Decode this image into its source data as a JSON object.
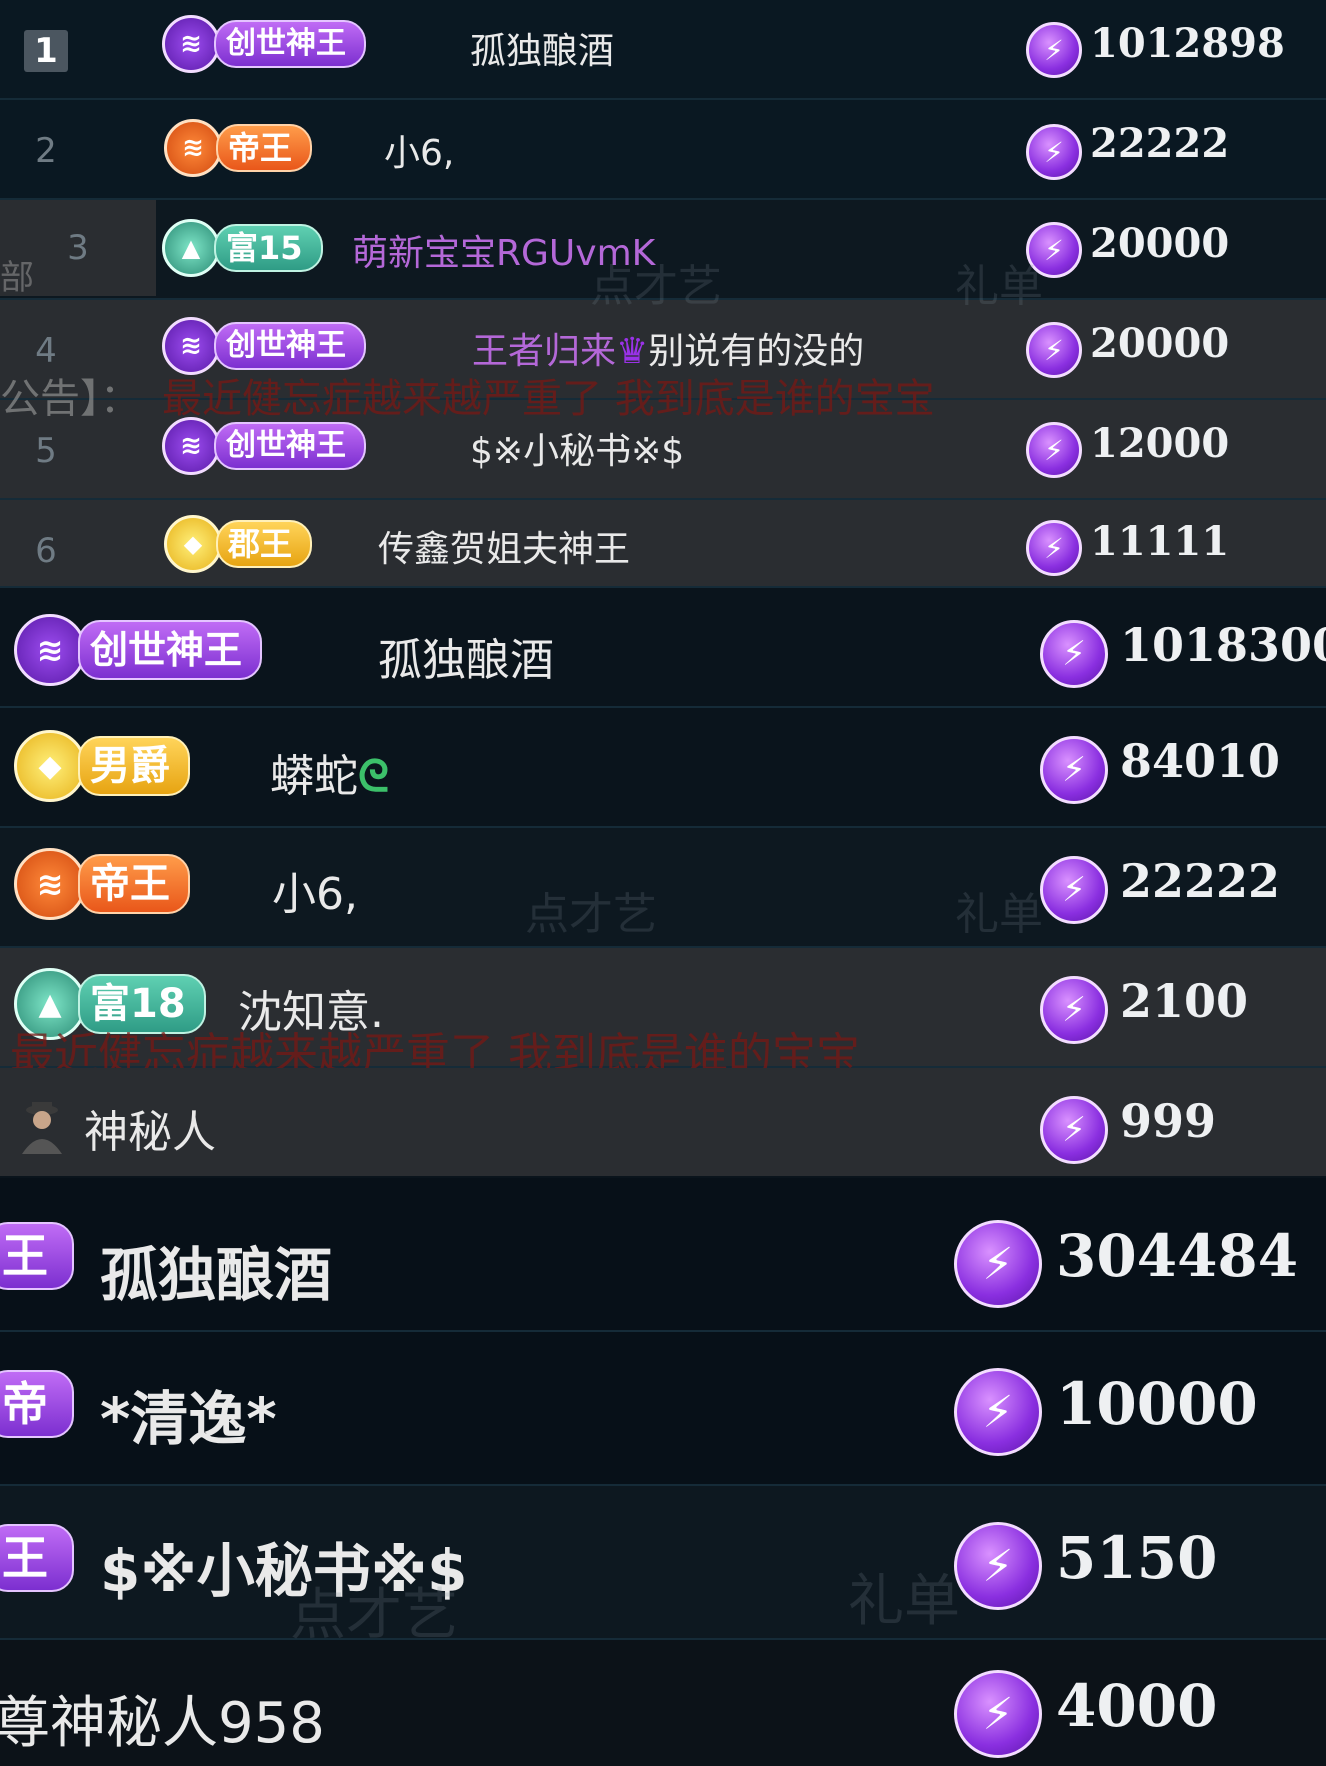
{
  "panel1": {
    "rows": [
      {
        "rank": "1",
        "badge": "创世神王",
        "name": "孤独酿酒",
        "score": "1012898"
      },
      {
        "rank": "2",
        "badge": "帝王",
        "name": "小6,",
        "score": "22222"
      },
      {
        "rank": "3",
        "badge": "富15",
        "name": "萌新宝宝RGUvmK",
        "score": "20000"
      },
      {
        "rank": "4",
        "badge": "创世神王",
        "name": "王者归来",
        "name_suffix": "别说有的没的",
        "score": "20000"
      },
      {
        "rank": "5",
        "badge": "创世神王",
        "name": "$※小秘书※$",
        "score": "12000"
      },
      {
        "rank": "6",
        "badge": "郡王",
        "name": "传鑫贺姐夫神王",
        "score": "11111"
      }
    ],
    "announcement_prefix": "公告】：",
    "announcement": "最近健忘症越来越严重了 我到底是谁的宝宝",
    "side_label_left": "部",
    "watermarks": [
      "点才艺",
      "礼单"
    ]
  },
  "panel2": {
    "rows": [
      {
        "badge": "创世神王",
        "name": "孤独酿酒",
        "score": "1018300"
      },
      {
        "badge": "男爵",
        "name": "蟒蛇",
        "score": "84010"
      },
      {
        "badge": "帝王",
        "name": "小6,",
        "score": "22222"
      },
      {
        "badge": "富18",
        "name": "沈知意.",
        "score": "2100"
      },
      {
        "badge": "",
        "name": "神秘人",
        "score": "999"
      }
    ],
    "announcement": "最近健忘症越来越严重了 我到底是谁的宝宝",
    "watermarks": [
      "点才艺",
      "礼单"
    ]
  },
  "panel3": {
    "rows": [
      {
        "badge_fragment": "王",
        "name": "孤独酿酒",
        "score": "304484"
      },
      {
        "badge_fragment": "帝",
        "name": "*清逸*",
        "score": "10000"
      },
      {
        "badge_fragment": "王",
        "name": "$※小秘书※$",
        "score": "5150"
      },
      {
        "badge_fragment": "",
        "name": "尊神秘人958",
        "score": "4000"
      }
    ],
    "watermarks": [
      "点才艺",
      "礼单"
    ]
  },
  "colors": {
    "coin": "#a44df0",
    "purple_badge": "#8a3ee0",
    "orange_badge": "#f06a22",
    "green_badge": "#3fb09a",
    "gold_badge": "#f2b21e",
    "announcement": "#7a1a14"
  },
  "icons": {
    "coin": "lightning-coin-icon",
    "emblem": "chevron-emblem-icon",
    "crown": "crown-icon",
    "snake": "snake-icon",
    "avatar": "mystery-avatar-icon"
  }
}
